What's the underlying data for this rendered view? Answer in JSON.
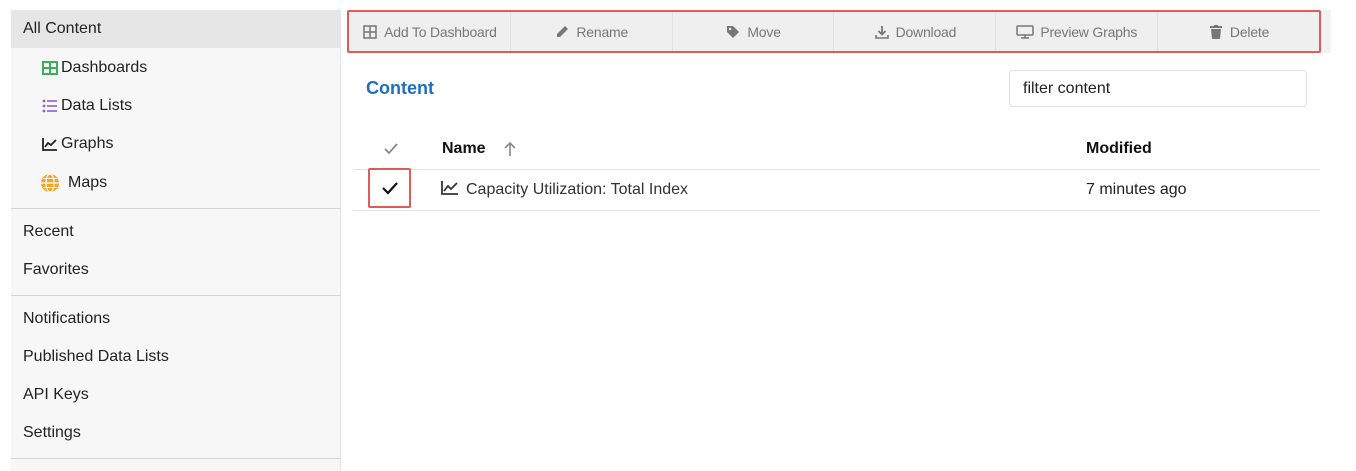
{
  "sidebar": {
    "all_content": "All Content",
    "sub_items": [
      {
        "label": "Dashboards",
        "icon": "dashboard-grid-icon",
        "color": "#3cae5a"
      },
      {
        "label": "Data Lists",
        "icon": "list-icon",
        "color": "#8a5ccf"
      },
      {
        "label": "Graphs",
        "icon": "line-chart-icon",
        "color": "#222222"
      },
      {
        "label": "Maps",
        "icon": "globe-icon",
        "color": "#f2a42b"
      }
    ],
    "group2": [
      "Recent",
      "Favorites"
    ],
    "group3": [
      "Notifications",
      "Published Data Lists",
      "API Keys",
      "Settings"
    ]
  },
  "toolbar": {
    "add_to_dashboard": "Add To Dashboard",
    "rename": "Rename",
    "move": "Move",
    "download": "Download",
    "preview_graphs": "Preview Graphs",
    "delete": "Delete"
  },
  "content": {
    "title": "Content",
    "filter_placeholder": "filter content"
  },
  "table": {
    "col_name": "Name",
    "col_modified": "Modified",
    "rows": [
      {
        "name": "Capacity Utilization: Total Index",
        "modified": "7 minutes ago",
        "checked": true
      }
    ]
  },
  "colors": {
    "accent": "#1f6fbf",
    "highlight": "#e05a5a"
  }
}
